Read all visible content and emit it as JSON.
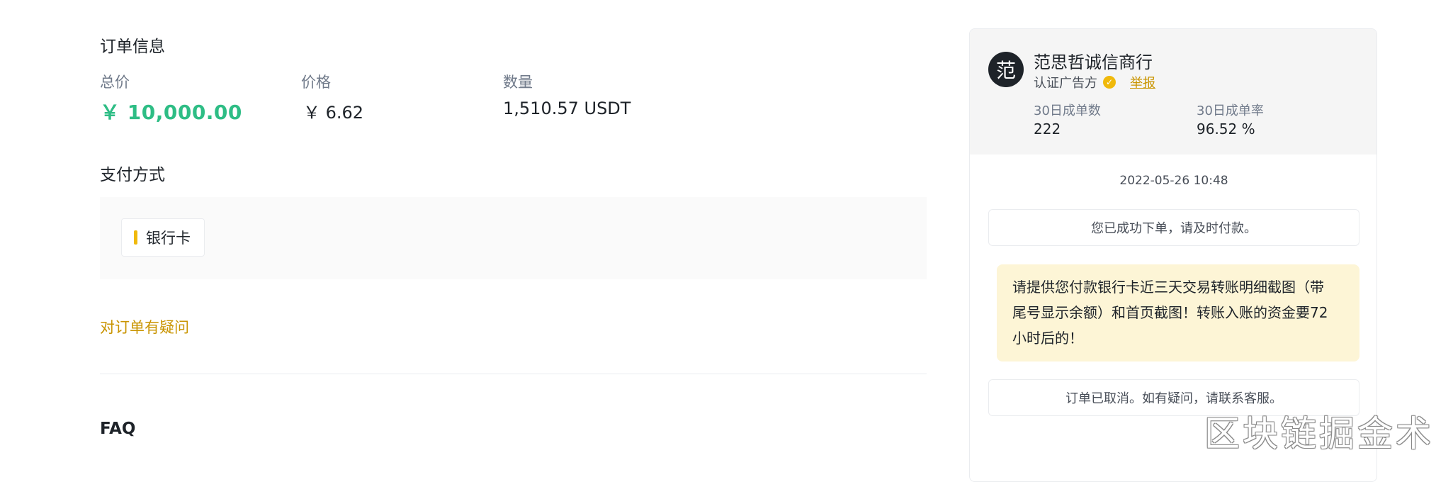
{
  "order_info": {
    "heading": "订单信息",
    "total_label": "总价",
    "total_value": "￥ 10,000.00",
    "price_label": "价格",
    "price_value": "￥ 6.62",
    "quantity_label": "数量",
    "quantity_value": "1,510.57 USDT"
  },
  "payment": {
    "heading": "支付方式",
    "method": "银行卡"
  },
  "question_link": "对订单有疑问",
  "faq_heading": "FAQ",
  "merchant": {
    "avatar_char": "范",
    "name": "范思哲诚信商行",
    "verified_label": "认证广告方",
    "report_link": "举报",
    "stats": [
      {
        "label": "30日成单数",
        "value": "222"
      },
      {
        "label": "30日成单率",
        "value": "96.52 %"
      }
    ]
  },
  "chat": {
    "timestamp": "2022-05-26 10:48",
    "msg_placed": "您已成功下单，请及时付款。",
    "msg_user_lines": [
      "请提供您付款银行卡近三天交易转账明细截图（带",
      "尾号显示余额）和首页截图！转账入账的资金要72",
      "小时后的！"
    ],
    "msg_cancelled": "订单已取消。如有疑问，请联系客服。"
  },
  "watermark": "区块链掘金术",
  "colors": {
    "accent": "#f0b90b",
    "link": "#c99400",
    "total_green": "#2ebd85"
  }
}
